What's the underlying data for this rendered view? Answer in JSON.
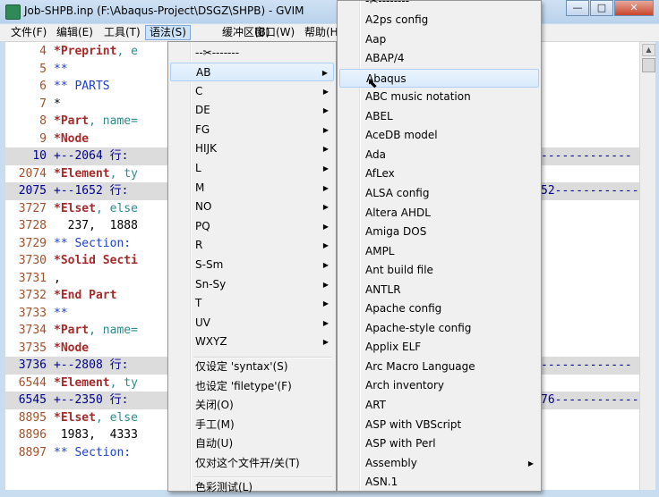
{
  "window": {
    "title": "Job-SHPB.inp (F:\\Abaqus-Project\\DSGZ\\SHPB) - GVIM",
    "minimize_glyph": "—",
    "maximize_glyph": "□",
    "close_glyph": "✕"
  },
  "menubar": {
    "file": "文件(F)",
    "edit": "编辑(E)",
    "tools": "工具(T)",
    "syntax": "语法(S)",
    "buffers": "缓冲区(B)",
    "window": "窗口(W)",
    "help": "帮助(H"
  },
  "editor": {
    "lines": [
      {
        "num": "4",
        "kw": "*Preprint",
        "rest": ", e"
      },
      {
        "num": "5",
        "cm": "**"
      },
      {
        "num": "6",
        "cm": "** PARTS"
      },
      {
        "num": "7",
        "tx": "*"
      },
      {
        "num": "8",
        "kw": "*Part",
        "rest": ", name="
      },
      {
        "num": "9",
        "kw": "*Node"
      },
      {
        "num": "10",
        "fold": "+--2064 行:",
        "tail": "-------------"
      },
      {
        "num": "2074",
        "kw": "*Element",
        "rest": ", ty"
      },
      {
        "num": "2075",
        "fold": "+--1652 行:",
        "tail": "52------------"
      },
      {
        "num": "3727",
        "kw": "*Elset",
        "rest": ", else"
      },
      {
        "num": "3728",
        "tx": "  237,  1888"
      },
      {
        "num": "3729",
        "cm": "** Section:"
      },
      {
        "num": "3730",
        "kw": "*Solid Secti"
      },
      {
        "num": "3731",
        "tx": ","
      },
      {
        "num": "3732",
        "kw": "*End Part"
      },
      {
        "num": "3733",
        "cm": "**"
      },
      {
        "num": "3734",
        "kw": "*Part",
        "rest": ", name="
      },
      {
        "num": "3735",
        "kw": "*Node"
      },
      {
        "num": "3736",
        "fold": "+--2808 行:",
        "tail": "-------------"
      },
      {
        "num": "6544",
        "kw": "*Element",
        "rest": ", ty"
      },
      {
        "num": "6545",
        "fold": "+--2350 行:",
        "tail": "76------------"
      },
      {
        "num": "8895",
        "kw": "*Elset",
        "rest": ", else"
      },
      {
        "num": "8896",
        "tx": " 1983,  4333"
      },
      {
        "num": "8897",
        "cm": "** Section:"
      }
    ]
  },
  "syntax_menu": {
    "tearoff": "--✂-------",
    "items": [
      {
        "label": "AB",
        "submenu": true
      },
      {
        "label": "C",
        "submenu": true
      },
      {
        "label": "DE",
        "submenu": true
      },
      {
        "label": "FG",
        "submenu": true
      },
      {
        "label": "HIJK",
        "submenu": true
      },
      {
        "label": "L",
        "submenu": true
      },
      {
        "label": "M",
        "submenu": true
      },
      {
        "label": "NO",
        "submenu": true
      },
      {
        "label": "PQ",
        "submenu": true
      },
      {
        "label": "R",
        "submenu": true
      },
      {
        "label": "S-Sm",
        "submenu": true
      },
      {
        "label": "Sn-Sy",
        "submenu": true
      },
      {
        "label": "T",
        "submenu": true
      },
      {
        "label": "UV",
        "submenu": true
      },
      {
        "label": "WXYZ",
        "submenu": true
      }
    ],
    "actions": [
      "仅设定 'syntax'(S)",
      "也设定 'filetype'(F)",
      "关闭(O)",
      "手工(M)",
      "自动(U)",
      "仅对这个文件开/关(T)"
    ],
    "cut_off_item": "色彩测试(L)"
  },
  "ab_submenu": {
    "tearoff_partial": "-✂--------",
    "items": [
      {
        "label": "A2ps config"
      },
      {
        "label": "Aap"
      },
      {
        "label": "ABAP/4"
      },
      {
        "label": "Abaqus"
      },
      {
        "label": "ABC music notation"
      },
      {
        "label": "ABEL"
      },
      {
        "label": "AceDB model"
      },
      {
        "label": "Ada"
      },
      {
        "label": "AfLex"
      },
      {
        "label": "ALSA config"
      },
      {
        "label": "Altera AHDL"
      },
      {
        "label": "Amiga DOS"
      },
      {
        "label": "AMPL"
      },
      {
        "label": "Ant build file"
      },
      {
        "label": "ANTLR"
      },
      {
        "label": "Apache config"
      },
      {
        "label": "Apache-style config"
      },
      {
        "label": "Applix ELF"
      },
      {
        "label": "Arc Macro Language"
      },
      {
        "label": "Arch inventory"
      },
      {
        "label": "ART"
      },
      {
        "label": "ASP with VBScript"
      },
      {
        "label": "ASP with Perl"
      },
      {
        "label": "Assembly",
        "submenu": true
      },
      {
        "label": "ASN.1"
      }
    ]
  }
}
